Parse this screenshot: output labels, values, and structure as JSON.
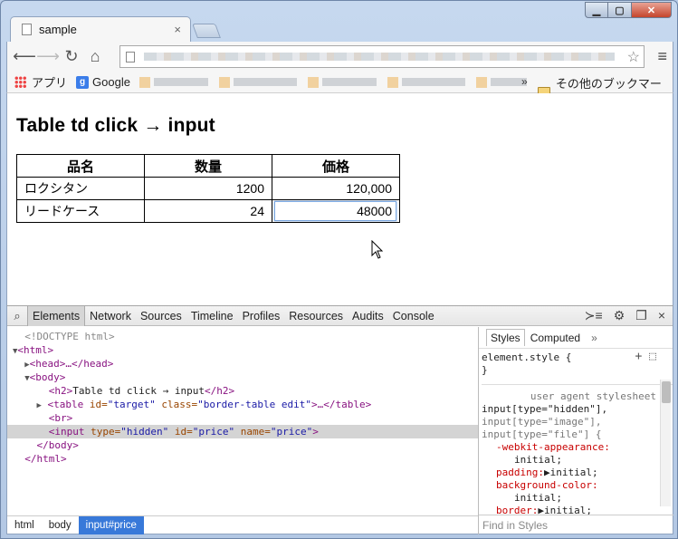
{
  "browser": {
    "tab_title": "sample",
    "tab_close": "×",
    "bookmarks": {
      "apps_label": "アプリ",
      "google_label": "Google",
      "google_icon_letter": "g",
      "overflow": "»",
      "other_label": "その他のブックマーク"
    }
  },
  "page": {
    "heading": "Table td click → input",
    "table": {
      "headers": [
        "品名",
        "数量",
        "価格"
      ],
      "rows": [
        {
          "name": "ロクシタン",
          "qty": "1200",
          "price": "120,000"
        },
        {
          "name": "リードケース",
          "qty": "24",
          "price": "48000"
        }
      ]
    }
  },
  "devtools": {
    "tabs": [
      "Elements",
      "Network",
      "Sources",
      "Timeline",
      "Profiles",
      "Resources",
      "Audits",
      "Console"
    ],
    "dom": {
      "doctype": "<!DOCTYPE html>",
      "html_open": "<html>",
      "head": "<head>…</head>",
      "body_open": "<body>",
      "h2_open": "<h2>",
      "h2_text": "Table td click → input",
      "h2_close": "</h2>",
      "table_open": "<table ",
      "table_id_attr": "id=",
      "table_id_val": "\"target\"",
      "table_class_attr": "class=",
      "table_class_val": "\"border-table edit\"",
      "table_end": ">…</table>",
      "br": "<br>",
      "input_open": "<input ",
      "input_type_attr": "type=",
      "input_type_val": "\"hidden\"",
      "input_id_attr": "id=",
      "input_id_val": "\"price\"",
      "input_name_attr": "name=",
      "input_name_val": "\"price\"",
      "input_close": ">",
      "body_close": "</body>",
      "html_close": "</html>"
    },
    "breadcrumbs": [
      "html",
      "body",
      "input#price"
    ],
    "styles": {
      "tabs": [
        "Styles",
        "Computed"
      ],
      "more": "»",
      "element_style": "element.style {",
      "close_brace": "}",
      "ua_label": "user agent stylesheet",
      "selector_1": "input[type=\"hidden\"],",
      "selector_2": "input[type=\"image\"],",
      "selector_3": "input[type=\"file\"] {",
      "props": [
        {
          "name": "-webkit-appearance:",
          "value": "initial;"
        },
        {
          "name": "padding:",
          "value": "▶initial;"
        },
        {
          "name": "background-color:",
          "value": "initial;"
        },
        {
          "name": "border:",
          "value": "▶initial;"
        }
      ],
      "find_placeholder": "Find in Styles"
    }
  }
}
